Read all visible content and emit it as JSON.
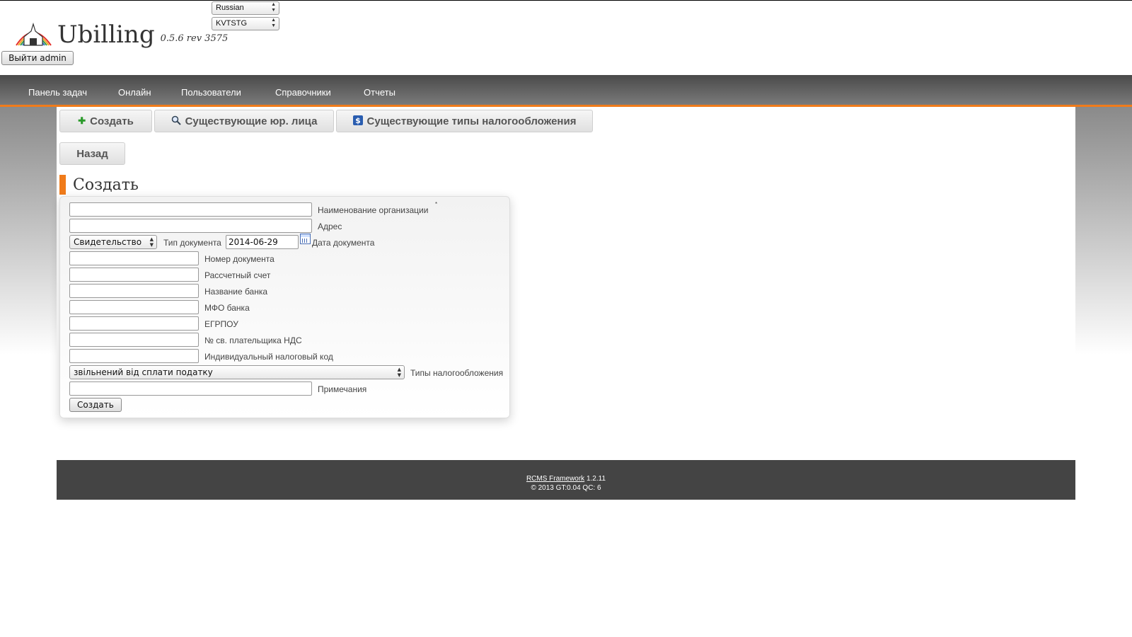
{
  "header": {
    "app_title": "Ubilling",
    "version": "0.5.6 rev 3575",
    "logout_label": "Выйти admin",
    "language_select": "Russian",
    "skin_select": "KVTSTG"
  },
  "nav": {
    "items": [
      "Панель задач",
      "Онлайн",
      "Пользователи",
      "Справочники",
      "Отчеты"
    ]
  },
  "toolbar": {
    "create_label": "Создать",
    "existing_entities_label": "Существующие юр. лица",
    "tax_types_label": "Существующие типы налогообложения",
    "back_label": "Назад"
  },
  "page_title": "Создать",
  "form": {
    "org_name_label": "Наименование организации",
    "required_mark": "*",
    "address_label": "Адрес",
    "doc_type_value": "Свидетельство",
    "doc_type_label": "Тип документа",
    "doc_date_value": "2014-06-29",
    "doc_date_label": "Дата документа",
    "doc_number_label": "Номер документа",
    "account_label": "Рассчетный счет",
    "bank_name_label": "Название банка",
    "bank_mfo_label": "МФО банка",
    "egrpou_label": "ЕГРПОУ",
    "vat_cert_label": "№ св. плательщика НДС",
    "inn_label": "Индивидуальный налоговый код",
    "tax_type_value": "звільнений від сплати податку",
    "tax_type_label": "Типы налогообложения",
    "notes_label": "Примечания",
    "submit_label": "Создать"
  },
  "footer": {
    "framework_link": "RCMS Framework",
    "framework_version": "1.2.11",
    "copyright": "© 2013 GT:0.04 QC: 6"
  },
  "colors": {
    "accent": "#f07b1a",
    "nav_bg": "#5a5a5a",
    "footer_bg": "#444444"
  }
}
